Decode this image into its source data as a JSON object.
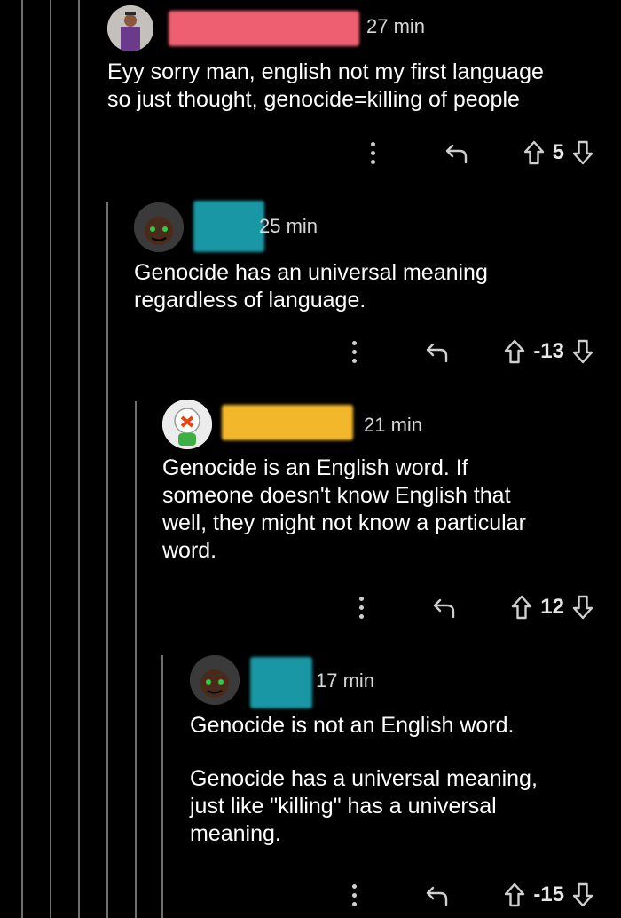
{
  "comments": [
    {
      "time": "27 min",
      "body": [
        "Eyy sorry man, english not my first language",
        "so just thought, genocide=killing of people"
      ],
      "score": "5",
      "redaction_color": "#f05a6e"
    },
    {
      "time": "25 min",
      "body": [
        "Genocide has an universal meaning",
        "regardless of language."
      ],
      "score": "-13",
      "redaction_color": "#1a9aa8"
    },
    {
      "time": "21 min",
      "body": [
        "Genocide is an English word. If",
        "someone doesn't know English that",
        "well, they might not know a particular",
        "word."
      ],
      "score": "12",
      "redaction_color": "#f2b62a"
    },
    {
      "time": "17 min",
      "body": [
        "Genocide is not an English word.",
        "",
        "Genocide has a universal meaning,",
        "just like \"killing\" has a universal",
        "meaning."
      ],
      "score": "-15",
      "redaction_color": "#1a9aa8"
    }
  ]
}
